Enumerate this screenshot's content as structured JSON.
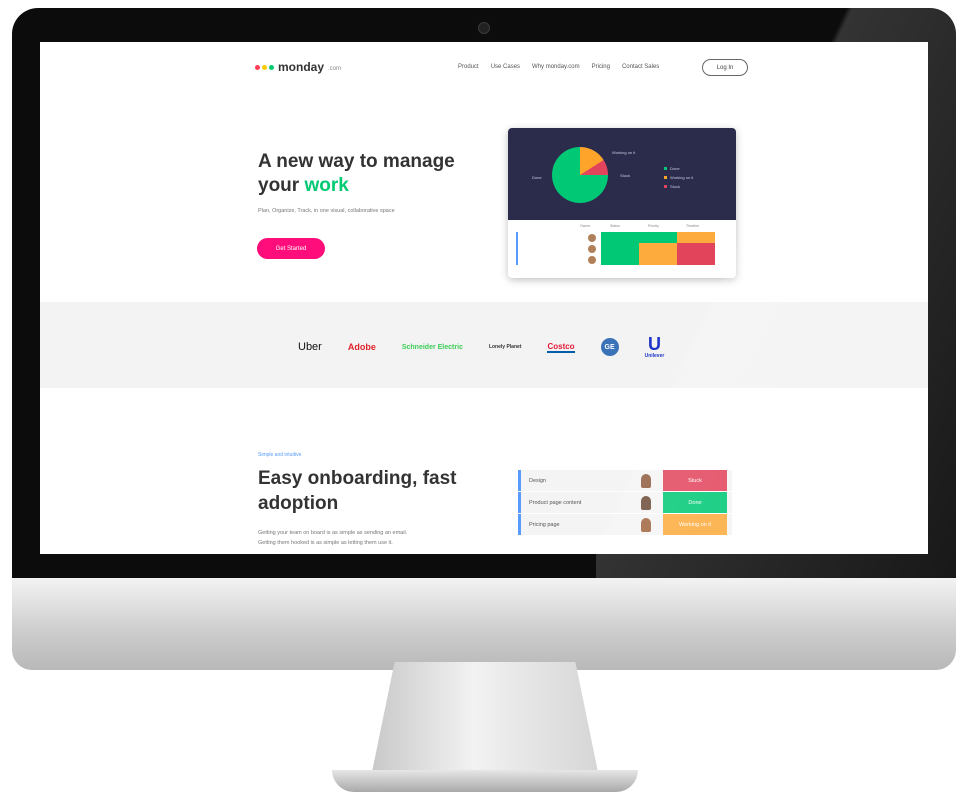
{
  "nav": {
    "logo_text": "monday",
    "logo_suffix": ".com",
    "links": [
      "Product",
      "Use Cases",
      "Why monday.com",
      "Pricing",
      "Contact Sales"
    ],
    "login": "Log In"
  },
  "hero": {
    "title_line1": "A new way to manage",
    "title_line2": "your",
    "title_accent": "work",
    "subtitle": "Plan, Organize, Track, in one visual, collaborative space",
    "cta": "Get Started"
  },
  "dashboard": {
    "pie": [
      {
        "name": "Stuck",
        "value": 9,
        "color": "#e2445c"
      },
      {
        "name": "Working on it",
        "value": 16,
        "color": "#ffa42b"
      },
      {
        "name": "Done",
        "value": 75,
        "color": "#00c875"
      }
    ],
    "pie_labels": [
      "Working on it",
      "Stuck",
      "Done"
    ],
    "legend": [
      "Done",
      "Working on it",
      "Stuck"
    ],
    "columns": [
      "Owner",
      "Status",
      "Priority",
      "Timeline"
    ],
    "rows": [
      {
        "cells": [
          "#00c875",
          "#00c875",
          "#fdab3d"
        ]
      },
      {
        "cells": [
          "#00c875",
          "#fdab3d",
          "#e2445c"
        ]
      },
      {
        "cells": [
          "#00c875",
          "#fdab3d",
          "#e2445c"
        ]
      }
    ]
  },
  "logos": [
    "Uber",
    "Adobe",
    "Schneider Electric",
    "Lonely Planet",
    "Costco",
    "GE",
    "Unilever"
  ],
  "onboarding": {
    "tag": "Simple and intuitive",
    "title_line1": "Easy onboarding, fast",
    "title_line2": "adoption",
    "desc_line1": "Getting your team on board is as simple as sending an email.",
    "desc_line2": "Getting them hooked is as simple as letting them use it.",
    "rows": [
      {
        "name": "Design",
        "status": "Stuck",
        "color": "#e2445c"
      },
      {
        "name": "Product page content",
        "status": "Done",
        "color": "#00c875"
      },
      {
        "name": "Pricing page",
        "status": "Working on it",
        "color": "#fdab3d"
      }
    ]
  },
  "colors": {
    "accent_green": "#00ca72",
    "cta_pink": "#ff0d7a",
    "link_blue": "#579bfc",
    "dashboard_dark": "#2b2c4c"
  }
}
